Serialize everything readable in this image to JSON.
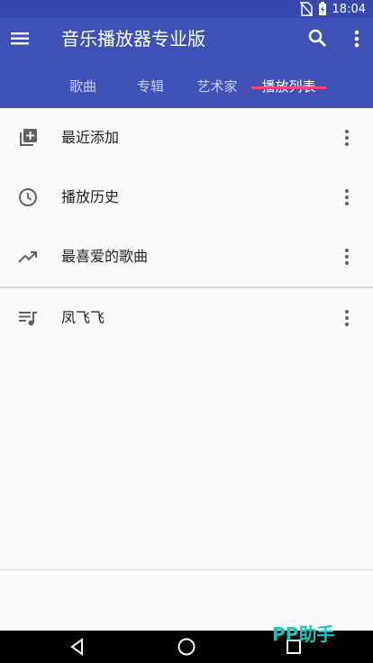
{
  "status_bar": {
    "time": "18:04",
    "icons": [
      "no-sim-icon",
      "battery-charging-icon"
    ]
  },
  "app_bar": {
    "title": "音乐播放器专业版",
    "icons": [
      "menu-icon",
      "search-icon",
      "more-vert-icon"
    ]
  },
  "tabs": [
    {
      "label": "歌曲",
      "active": false
    },
    {
      "label": "专辑",
      "active": false
    },
    {
      "label": "艺术家",
      "active": false
    },
    {
      "label": "播放列表",
      "active": true
    }
  ],
  "playlists": [
    {
      "label": "最近添加",
      "icon": "library-add-icon"
    },
    {
      "label": "播放历史",
      "icon": "history-icon"
    },
    {
      "label": "最喜爱的歌曲",
      "icon": "trending-up-icon"
    },
    {
      "label": "凤飞飞",
      "icon": "queue-music-icon"
    }
  ],
  "navigation_bar": {
    "icons": [
      "back-icon",
      "home-icon",
      "recent-apps-icon"
    ]
  },
  "watermark": {
    "text": "PP助手"
  },
  "colors": {
    "primary": "#3f51b5",
    "status_bar": "#3949ab",
    "accent": "#ff4081",
    "watermark": "#22c3b9"
  }
}
